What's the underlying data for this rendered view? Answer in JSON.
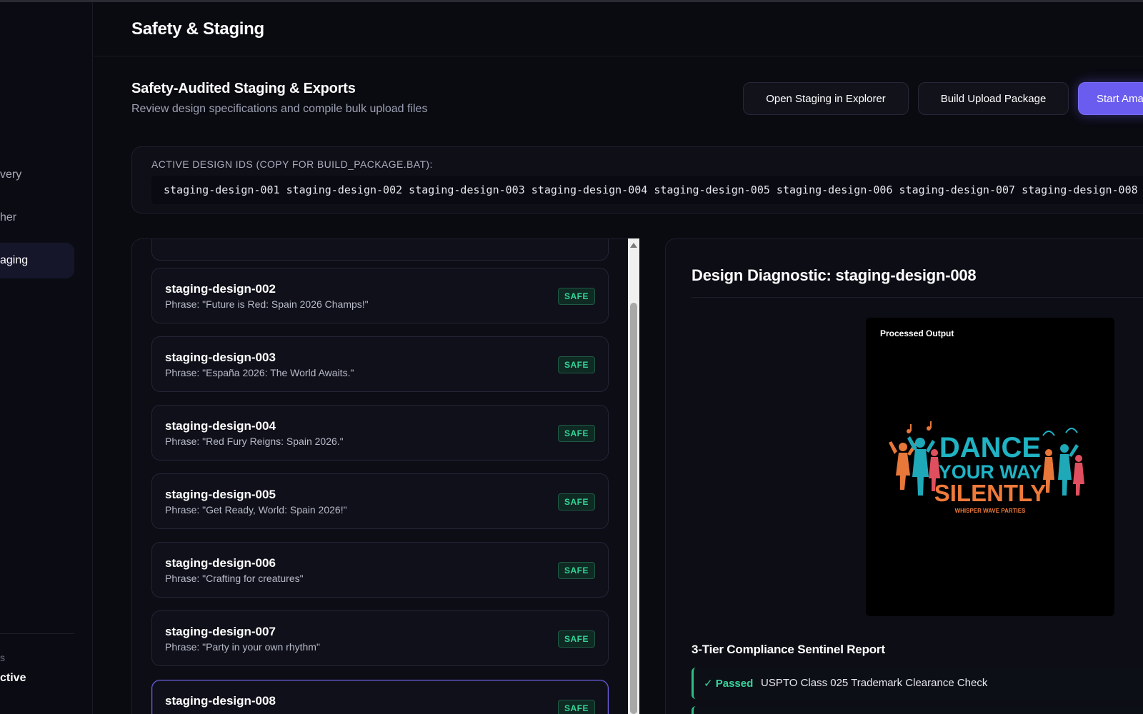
{
  "sidebar": {
    "items": [
      {
        "label": "very"
      },
      {
        "label": "her"
      },
      {
        "label": "aging"
      }
    ],
    "status_label": "s",
    "status_value": "ctive"
  },
  "header": {
    "title": "Safety & Staging"
  },
  "section": {
    "title": "Safety-Audited Staging & Exports",
    "subtitle": "Review design specifications and compile bulk upload files"
  },
  "buttons": {
    "open_staging": "Open Staging in Explorer",
    "build_package": "Build Upload Package",
    "start": "Start Ama"
  },
  "ids_box": {
    "label": "ACTIVE DESIGN IDS (COPY FOR BUILD_PACKAGE.BAT):",
    "value": "staging-design-001 staging-design-002 staging-design-003 staging-design-004 staging-design-005 staging-design-006 staging-design-007 staging-design-008"
  },
  "designs": [
    {
      "id": "staging-design-002",
      "phrase": "Phrase: \"Future is Red: Spain 2026 Champs!\"",
      "status": "SAFE"
    },
    {
      "id": "staging-design-003",
      "phrase": "Phrase: \"España 2026: The World Awaits.\"",
      "status": "SAFE"
    },
    {
      "id": "staging-design-004",
      "phrase": "Phrase: \"Red Fury Reigns: Spain 2026.\"",
      "status": "SAFE"
    },
    {
      "id": "staging-design-005",
      "phrase": "Phrase: \"Get Ready, World: Spain 2026!\"",
      "status": "SAFE"
    },
    {
      "id": "staging-design-006",
      "phrase": "Phrase: \"Crafting for creatures\"",
      "status": "SAFE"
    },
    {
      "id": "staging-design-007",
      "phrase": "Phrase: \"Party in your own rhythm\"",
      "status": "SAFE"
    },
    {
      "id": "staging-design-008",
      "phrase": "",
      "status": "SAFE"
    }
  ],
  "diagnostic": {
    "title": "Design Diagnostic: staging-design-008",
    "preview_label": "Processed Output",
    "artwork": {
      "line1": "DANCE",
      "line2": "YOUR WAY",
      "line3": "SILENTLY",
      "tagline": "WHISPER WAVE PARTIES"
    },
    "report_title": "3-Tier Compliance Sentinel Report",
    "checks": [
      {
        "status": "✓ Passed",
        "text": "USPTO Class 025 Trademark Clearance Check"
      }
    ]
  },
  "colors": {
    "accent": "#6b5cf0",
    "safe": "#35d49a",
    "background": "#0a0b11"
  }
}
